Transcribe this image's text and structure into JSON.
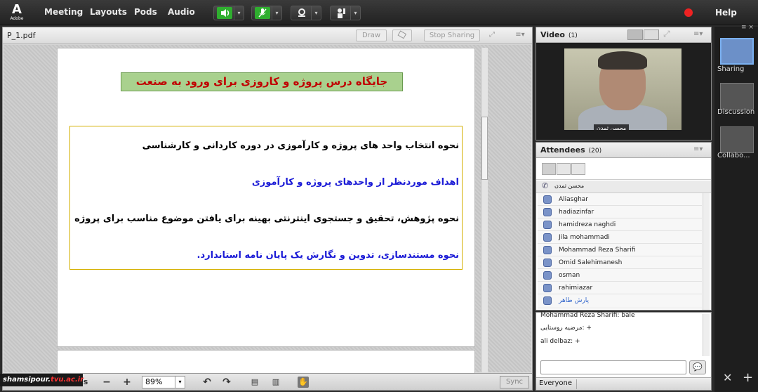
{
  "app": {
    "logo_letter": "A",
    "logo_text": "Adobe"
  },
  "menu": [
    "Meeting",
    "Layouts",
    "Pods",
    "Audio"
  ],
  "help_label": "Help",
  "share": {
    "title": "P_1.pdf",
    "draw_label": "Draw",
    "stop_sharing_label": "Stop Sharing",
    "menu_icon": "≡▾",
    "slide_title": "جایگاه درس پروژه و کاروزی برای ورود به صنعت",
    "lines": [
      "نحوه انتخاب واحد های پروژه و کارآموزی در دوره کاردانی و کارشناسی",
      "اهداف موردنظر از واحدهای پروژه و کارآموزی",
      "نحوه پژوهش، تحقیق و جستجوی اینترنتی بهینه برای یافتن موضوع مناسب برای پروژه",
      "نحوه مستندسازی، تدوین و نگارش یک پایان نامه استاندارد."
    ],
    "line_colors": [
      "#000000",
      "#1a1ad6",
      "#000000",
      "#1a1ad6"
    ],
    "zoom": "89%",
    "sync_label": "Sync",
    "page_indicator": "s"
  },
  "watermark": {
    "prefix": "shamsipour.",
    "org": "tvu.ac.ir"
  },
  "video": {
    "title": "Video",
    "count": "(1)",
    "name_tag": "محسن ثمدن"
  },
  "attendees": {
    "title": "Attendees",
    "count": "(20)",
    "host": "محسن ثمدن",
    "list": [
      "Aliasghar",
      "hadiazinfar",
      "hamidreza naghdi",
      "Jila mohammadi",
      "Mohammad Reza Sharifi",
      "Omid Salehimanesh",
      "osman",
      "rahimiazar",
      "پارش طاهر"
    ]
  },
  "chat": {
    "lines": [
      "Mohammad Reza Sharifi: bale",
      "+ :مرضیه روستایی",
      "ali delbaz: +"
    ],
    "audience": "Everyone"
  },
  "layouts": [
    {
      "label": "Sharing"
    },
    {
      "label": "Discussion"
    },
    {
      "label": "Collabo..."
    }
  ]
}
